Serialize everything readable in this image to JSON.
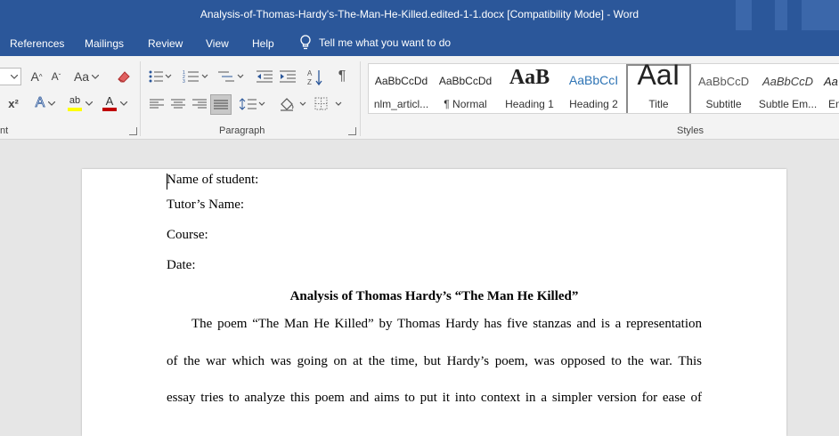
{
  "window": {
    "title": "Analysis-of-Thomas-Hardy's-The-Man-He-Killed.edited-1-1.docx [Compatibility Mode]  -  Word"
  },
  "menu": {
    "tabs": [
      "References",
      "Mailings",
      "Review",
      "View",
      "Help"
    ],
    "tell_me": "Tell me what you want to do"
  },
  "ribbon": {
    "groups": {
      "font_partial": "nt",
      "paragraph": "Paragraph",
      "styles": "Styles"
    },
    "font": {
      "grow_label": "A",
      "shrink_label": "A",
      "case_label": "Aa",
      "superscript_label": "x²",
      "text_effects_label": "A",
      "highlight_label": "ab",
      "font_color_label": "A"
    },
    "paragraph": {
      "pilcrow": "¶"
    },
    "styles": [
      {
        "preview": "AaBbCcDd",
        "name": "nlm_articl..."
      },
      {
        "preview": "AaBbCcDd",
        "name": "¶ Normal"
      },
      {
        "preview": "AaB",
        "name": "Heading 1"
      },
      {
        "preview": "AaBbCcI",
        "name": "Heading 2"
      },
      {
        "preview": "AaI",
        "name": "Title"
      },
      {
        "preview": "AaBbCcD",
        "name": "Subtitle"
      },
      {
        "preview": "AaBbCcD",
        "name": "Subtle Em..."
      },
      {
        "preview": "Aa",
        "name": "Em"
      }
    ]
  },
  "document": {
    "name_of_student": "Name of student:",
    "tutor_name": "Tutor’s Name:",
    "course": "Course:",
    "date": "Date:",
    "heading": "Analysis of Thomas Hardy’s “The Man He Killed”",
    "para_line1": "The poem “The Man He Killed” by Thomas Hardy has five stanzas and is a representation",
    "para_line2": "of the war which was going on at the time, but Hardy’s poem, was opposed to the war. This",
    "para_line3": "essay tries to analyze this poem and aims to put it into context in a simpler version for ease of"
  },
  "colors": {
    "titlebar": "#2b579a",
    "ribbon": "#f3f3f3",
    "document_bg": "#e6e6e6",
    "font_color_underline": "#c00000",
    "highlight_underline": "#ffff00",
    "text_effects": "#2b579a"
  }
}
